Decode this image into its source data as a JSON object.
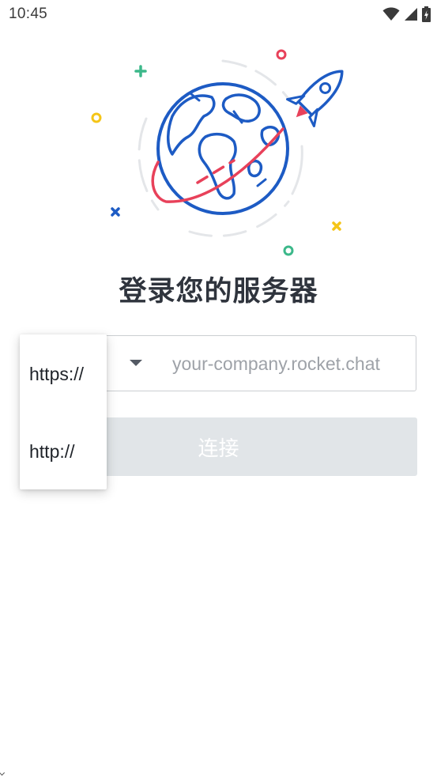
{
  "status_bar": {
    "time": "10:45",
    "icons": [
      "wifi-icon",
      "cellular-signal-icon",
      "battery-charging-icon"
    ]
  },
  "illustration": {
    "description_icon": "globe-rocket-illustration-icon",
    "colors": {
      "globe": "#1d5bc4",
      "rocket_trail": "#e8415a",
      "plus": "#3cb88a",
      "ring_yellow": "#f5c517",
      "ring_red": "#e8415a",
      "ring_green": "#3cb88a",
      "cross_blue": "#1d5bc4",
      "cross_yellow": "#f5c517",
      "orbit": "#e4e6e9"
    }
  },
  "login": {
    "title": "登录您的服务器",
    "url_field": {
      "placeholder": "your-company.rocket.chat",
      "value": ""
    },
    "connect_label": "连接"
  },
  "protocol_menu": {
    "options": [
      "https://",
      "http://"
    ]
  },
  "colors": {
    "button_disabled_bg": "#e1e5e8",
    "field_border": "#cbced1",
    "placeholder": "#9ea2a8",
    "title_text": "#2f343d"
  }
}
